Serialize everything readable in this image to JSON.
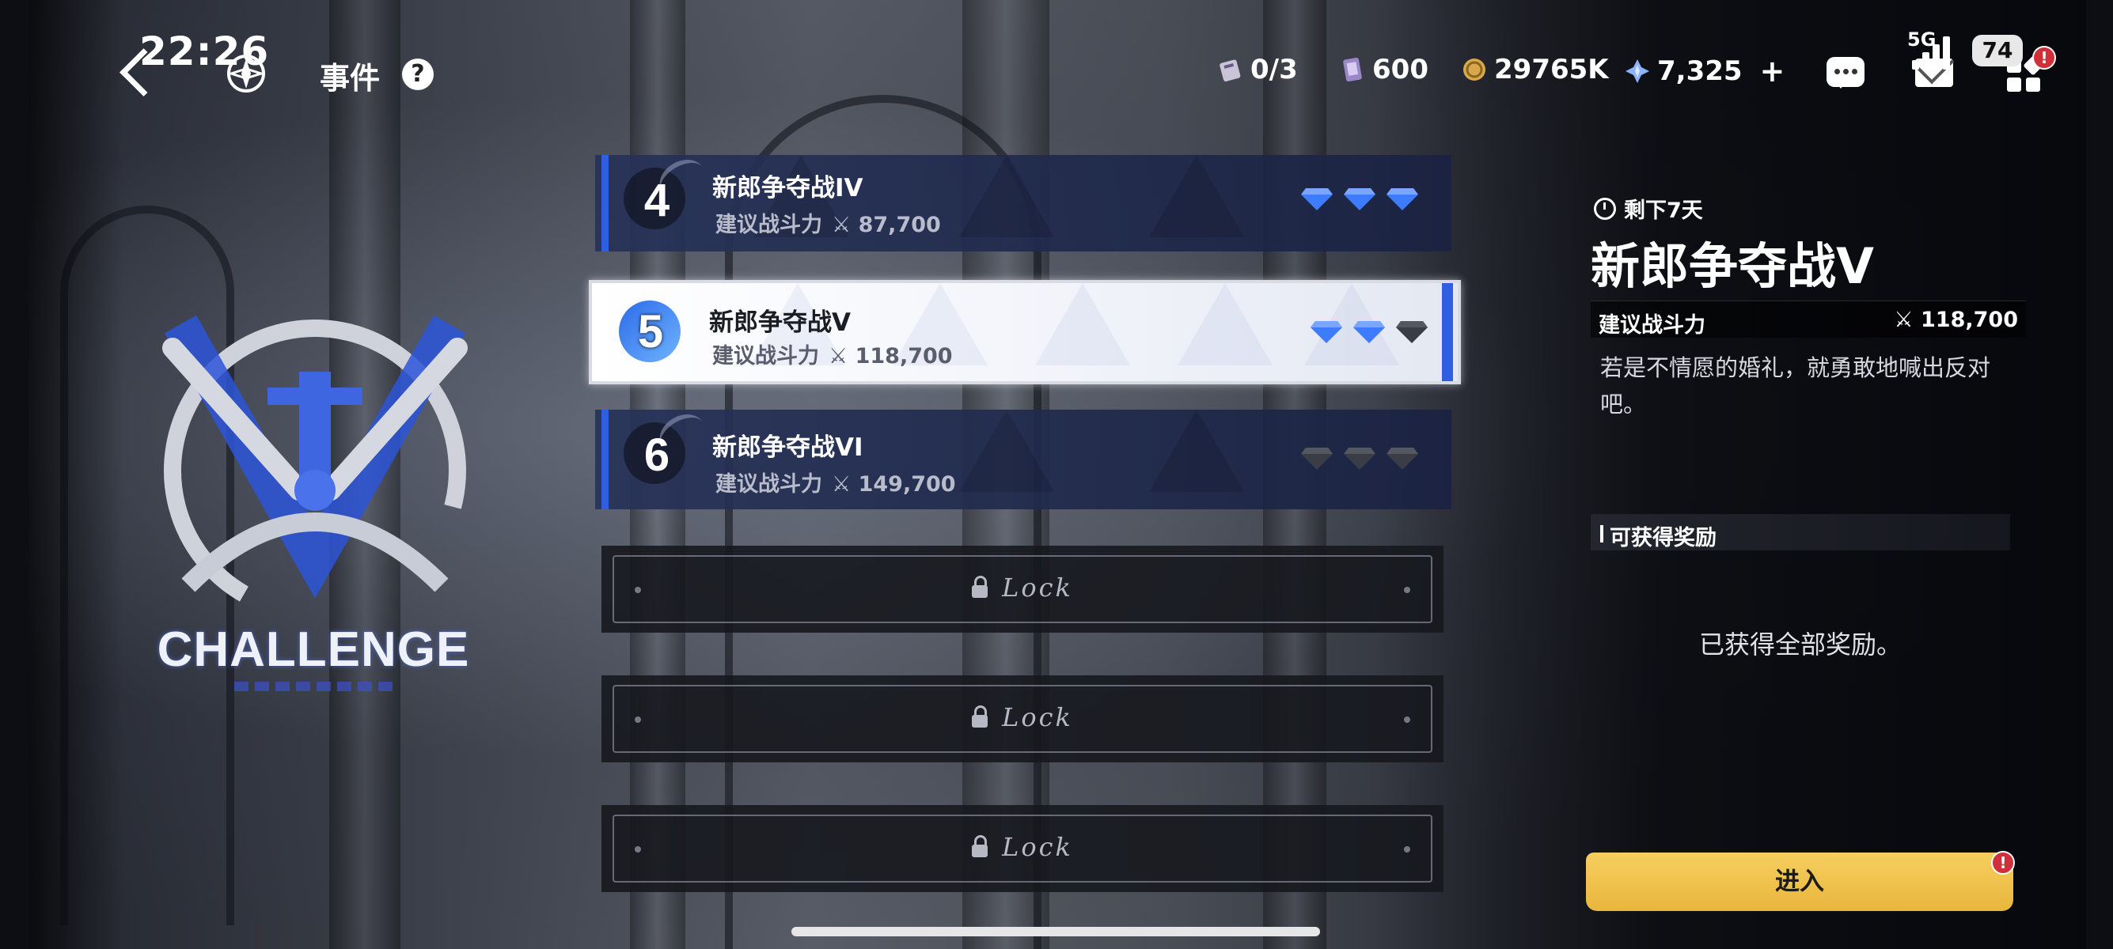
{
  "status": {
    "time": "22:26",
    "network": "5G",
    "battery": "74"
  },
  "header": {
    "title": "事件",
    "help": "?"
  },
  "resources": [
    {
      "icon": "ticket-icon",
      "value": "0/3"
    },
    {
      "icon": "card-icon",
      "value": "600"
    },
    {
      "icon": "coin-icon",
      "value": "29765K"
    },
    {
      "icon": "crystal-icon",
      "value": "7,325"
    }
  ],
  "plus_label": "+",
  "badge": "!",
  "logo": {
    "text": "CHALLENGE"
  },
  "stages": [
    {
      "num": "4",
      "name": "新郎争夺战IV",
      "power_label": "建议战斗力",
      "power": "87,700",
      "stars": 3
    },
    {
      "num": "5",
      "name": "新郎争夺战V",
      "power_label": "建议战斗力",
      "power": "118,700",
      "stars": 2
    },
    {
      "num": "6",
      "name": "新郎争夺战VI",
      "power_label": "建议战斗力",
      "power": "149,700",
      "stars": 0
    }
  ],
  "locked": [
    {
      "label": "Lock"
    },
    {
      "label": "Lock"
    },
    {
      "label": "Lock"
    }
  ],
  "detail": {
    "timer": "剩下7天",
    "title": "新郎争夺战V",
    "power_label": "建议战斗力",
    "power": "118,700",
    "description": "若是不情愿的婚礼，就勇敢地喊出反对吧。",
    "reward_header": "可获得奖励",
    "reward_status": "已获得全部奖励。",
    "enter_button": "进入"
  },
  "colors": {
    "accent": "#2f5fe0",
    "enter": "#f0c24c",
    "gem_on": "#3d7bff",
    "gem_off": "#3a3d46"
  }
}
